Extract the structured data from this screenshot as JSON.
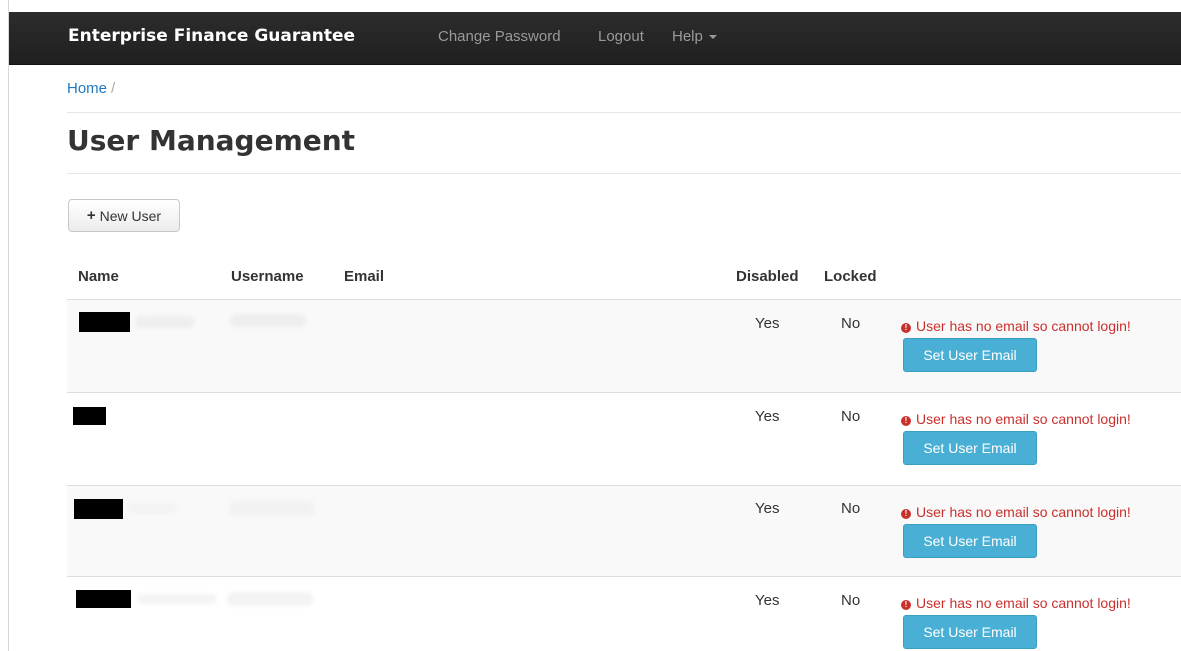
{
  "navbar": {
    "brand": "Enterprise Finance Guarantee",
    "links": {
      "change_password": "Change Password",
      "logout": "Logout",
      "help": "Help"
    }
  },
  "breadcrumb": {
    "home": "Home",
    "separator": "/"
  },
  "page": {
    "title": "User Management"
  },
  "actions": {
    "new_user": "New User"
  },
  "table": {
    "headers": {
      "name": "Name",
      "username": "Username",
      "email": "Email",
      "disabled": "Disabled",
      "locked": "Locked"
    },
    "rows": [
      {
        "disabled": "Yes",
        "locked": "No",
        "warning": "User has no email so cannot login!",
        "action": "Set User Email"
      },
      {
        "disabled": "Yes",
        "locked": "No",
        "warning": "User has no email so cannot login!",
        "action": "Set User Email"
      },
      {
        "disabled": "Yes",
        "locked": "No",
        "warning": "User has no email so cannot login!",
        "action": "Set User Email"
      },
      {
        "disabled": "Yes",
        "locked": "No",
        "warning": "User has no email so cannot login!",
        "action": "Set User Email"
      }
    ]
  },
  "colors": {
    "navbar_bg": "#222222",
    "link": "#1f78c0",
    "danger": "#c9302c",
    "info_button": "#49afd4"
  },
  "icons": {
    "plus": "plus-icon",
    "warning": "exclamation-circle-icon",
    "help_caret": "caret-down-icon"
  }
}
